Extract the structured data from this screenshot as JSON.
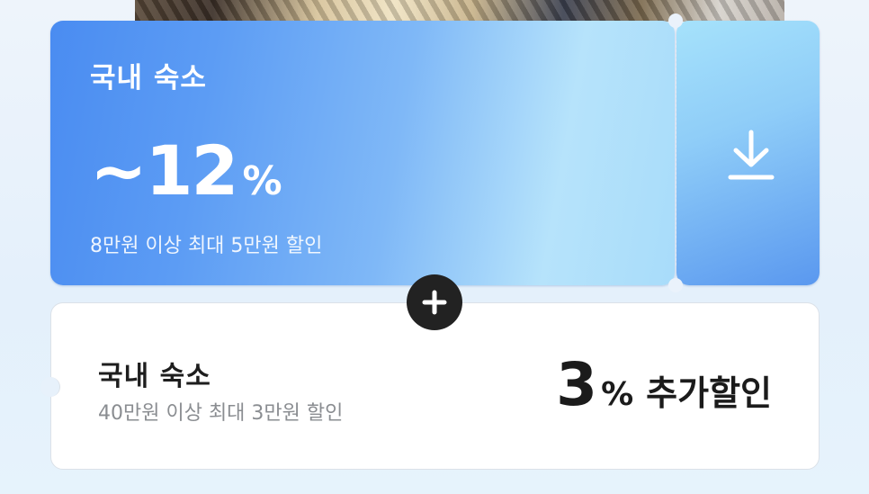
{
  "coupon_primary": {
    "title": "국내 숙소",
    "amount": "~12",
    "percent_sign": "%",
    "description": "8만원 이상 최대 5만원 할인",
    "download_icon": "download-icon"
  },
  "combine_icon": "plus-icon",
  "coupon_secondary": {
    "title": "국내 숙소",
    "description": "40만원 이상 최대 3만원 할인",
    "amount": "3",
    "percent_sign": "%",
    "label": "추가할인"
  }
}
